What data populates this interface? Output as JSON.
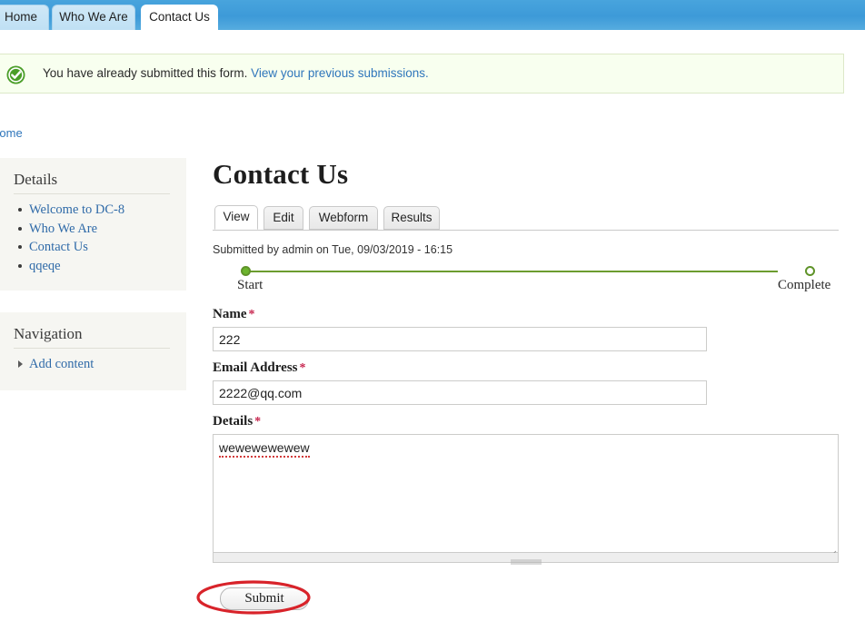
{
  "topnav": {
    "tabs": [
      {
        "label": "Home",
        "active": false
      },
      {
        "label": "Who We Are",
        "active": false
      },
      {
        "label": "Contact Us",
        "active": true
      }
    ]
  },
  "status": {
    "icon": "check-circle-icon",
    "message": "You have already submitted this form.",
    "link_label": "View your previous submissions.",
    "bg_color": "#f8ffef",
    "border_color": "#dce8c8",
    "icon_color": "#4a9e28",
    "link_color": "#2f76bb"
  },
  "breadcrumb": {
    "items": [
      "Home"
    ]
  },
  "sidebar": {
    "blocks": [
      {
        "title": "Details",
        "items": [
          {
            "label": "Welcome to DC-8"
          },
          {
            "label": "Who We Are"
          },
          {
            "label": "Contact Us"
          },
          {
            "label": "qqeqe"
          }
        ]
      },
      {
        "title": "Navigation",
        "items": [
          {
            "label": "Add content"
          }
        ]
      }
    ]
  },
  "main": {
    "title": "Contact Us",
    "tabs": [
      {
        "label": "View",
        "active": true
      },
      {
        "label": "Edit",
        "active": false
      },
      {
        "label": "Webform",
        "active": false
      },
      {
        "label": "Results",
        "active": false
      }
    ],
    "submitted_info": "Submitted by admin on Tue, 09/03/2019 - 16:15",
    "progress": {
      "start_label": "Start",
      "complete_label": "Complete",
      "line_color": "#6c9c2f",
      "start_filled": true,
      "complete_filled": false,
      "percent": 0
    },
    "form": {
      "fields": [
        {
          "label": "Name",
          "required_marker": "*",
          "value": "222",
          "placeholder": "",
          "type": "text"
        },
        {
          "label": "Email Address",
          "required_marker": "*",
          "value": "2222@qq.com",
          "placeholder": "",
          "type": "text"
        },
        {
          "label": "Details",
          "required_marker": "*",
          "value": "wewewewewew",
          "placeholder": "",
          "type": "textarea"
        }
      ],
      "submit_label": "Submit"
    }
  },
  "annotation": {
    "shape": "ellipse",
    "color": "#d8232a",
    "target": "submit-button"
  }
}
